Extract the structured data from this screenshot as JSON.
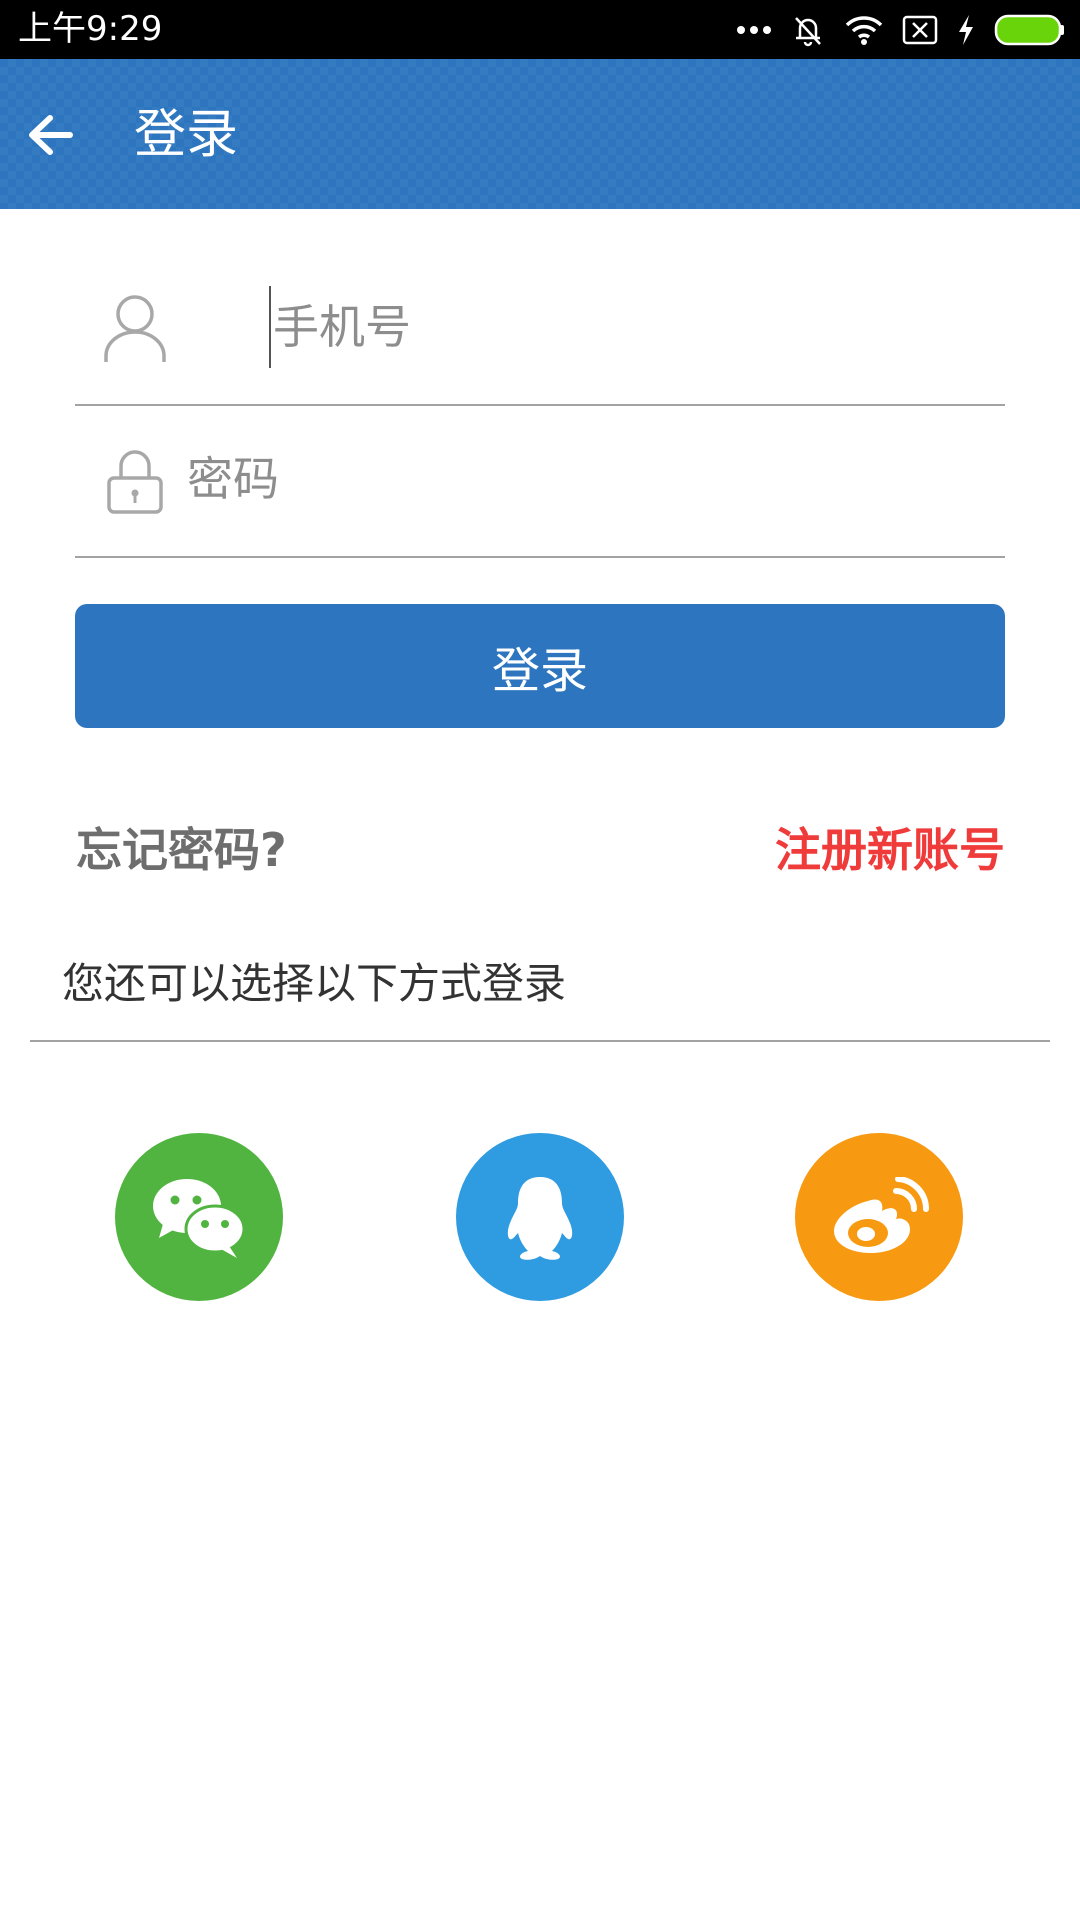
{
  "status_bar": {
    "time": "上午9:29"
  },
  "header": {
    "title": "登录",
    "back_icon": "arrow-left-icon",
    "background_color": "#2d76bf"
  },
  "form": {
    "phone": {
      "icon": "user-icon",
      "placeholder": "手机号",
      "value": ""
    },
    "password": {
      "icon": "lock-icon",
      "placeholder": "密码",
      "value": ""
    },
    "login_button": "登录"
  },
  "links": {
    "forgot_password": "忘记密码?",
    "register": "注册新账号",
    "register_color": "#f03b3b"
  },
  "alternative_login": {
    "text": "您还可以选择以下方式登录",
    "providers": [
      {
        "icon": "wechat-icon",
        "color": "#52b440"
      },
      {
        "icon": "qq-icon",
        "color": "#2f9be0"
      },
      {
        "icon": "weibo-icon",
        "color": "#f79a12"
      }
    ]
  }
}
